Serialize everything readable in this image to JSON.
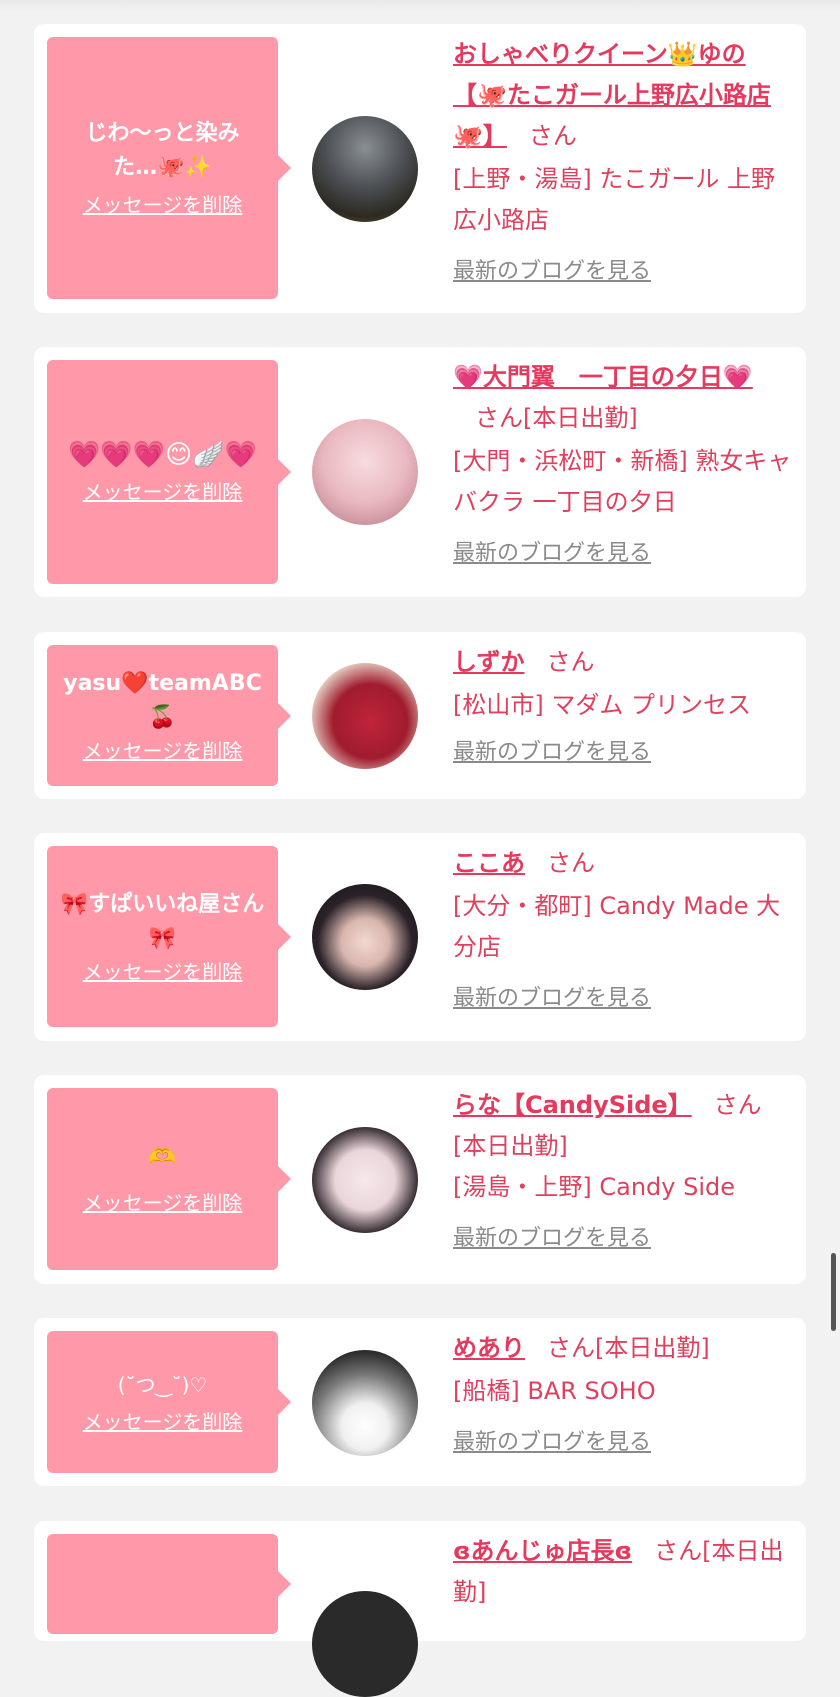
{
  "cards": [
    {
      "message": "じわ〜っと染みた…🐙✨",
      "delete_label": "メッセージを削除",
      "name": "おしゃべりクイーン👑ゆの【🐙たこガール上野広小路店🐙】",
      "honorific": "さん",
      "status": "",
      "shop": "[上野・湯島] たこガール 上野広小路店",
      "blog_label": "最新のブログを見る"
    },
    {
      "message": "💗💗💗😊🪽💗",
      "delete_label": "メッセージを削除",
      "name": "💗大門翼　一丁目の夕日💗",
      "honorific": "さん",
      "status": "[本日出勤]",
      "shop": "[大門・浜松町・新橋] 熟女キャバクラ 一丁目の夕日",
      "blog_label": "最新のブログを見る"
    },
    {
      "message": "yasu❤️teamABC🍒",
      "delete_label": "メッセージを削除",
      "name": "しずか",
      "honorific": "さん",
      "status": "",
      "shop": "[松山市] マダム プリンセス",
      "blog_label": "最新のブログを見る"
    },
    {
      "message": "🎀すぱいいね屋さん🎀",
      "delete_label": "メッセージを削除",
      "name": "ここあ",
      "honorific": "さん",
      "status": "",
      "shop": "[大分・都町] Candy Made 大分店",
      "blog_label": "最新のブログを見る"
    },
    {
      "message": "🫶",
      "delete_label": "メッセージを削除",
      "name": "らな【CandySide】",
      "honorific": "さん",
      "status": "[本日出勤]",
      "shop": "[湯島・上野] Candy Side",
      "blog_label": "最新のブログを見る"
    },
    {
      "message": "(˘つ‿˘)♡",
      "delete_label": "メッセージを削除",
      "name": "めあり",
      "honorific": "さん",
      "status": "[本日出勤]",
      "shop": "[船橋] BAR SOHO",
      "blog_label": "最新のブログを見る"
    },
    {
      "message": "",
      "delete_label": "",
      "name": "ɞあんじゅ店長ɞ",
      "honorific": "さん",
      "status": "[本日出勤]",
      "shop": "",
      "blog_label": ""
    }
  ],
  "colors": {
    "accent": "#e5395e",
    "bubble": "#ff99a9",
    "background": "#f2f2f2",
    "link_gray": "#8a8a8a"
  }
}
